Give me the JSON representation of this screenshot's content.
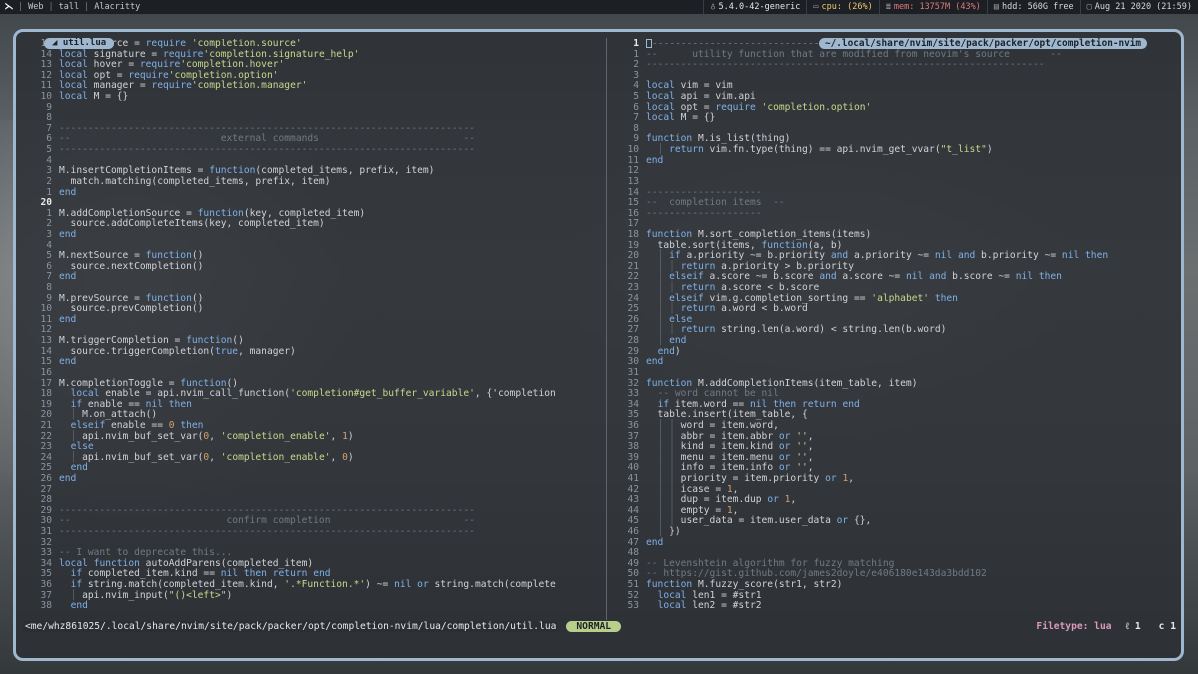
{
  "topbar": {
    "logo": "⋋",
    "workspaces": [
      "Web",
      "tall",
      "Alacritty"
    ],
    "kernel_icon": "♁",
    "kernel": "5.4.0-42-generic",
    "cpu_icon": "▭",
    "cpu": "cpu: (26%)",
    "mem_icon": "≣",
    "mem": "mem: 13757M (43%)",
    "hdd_icon": "▤",
    "hdd": "hdd: 560G free",
    "date_icon": "▢",
    "date": "Aug 21 2020 (21:59)"
  },
  "editor": {
    "left_tab": "◢ util.lua",
    "right_path": "~/.local/share/nvim/site/pack/packer/opt/completion-nvim",
    "left_lines": [
      {
        "n": "15",
        "c": "local source = require 'completion.source'"
      },
      {
        "n": "14",
        "c": "local signature = require'completion.signature_help'"
      },
      {
        "n": "13",
        "c": "local hover = require'completion.hover'"
      },
      {
        "n": "12",
        "c": "local opt = require'completion.option'"
      },
      {
        "n": "11",
        "c": "local manager = require'completion.manager'"
      },
      {
        "n": "10",
        "c": "local M = {}"
      },
      {
        "n": "9",
        "c": ""
      },
      {
        "n": "8",
        "c": ""
      },
      {
        "n": "7",
        "c": "------------------------------------------------------------------------"
      },
      {
        "n": "6",
        "c": "--                          external commands                         --"
      },
      {
        "n": "5",
        "c": "------------------------------------------------------------------------"
      },
      {
        "n": "4",
        "c": ""
      },
      {
        "n": "3",
        "c": "M.insertCompletionItems = function(completed_items, prefix, item)"
      },
      {
        "n": "2",
        "c": "  match.matching(completed_items, prefix, item)"
      },
      {
        "n": "1",
        "c": "end"
      },
      {
        "n": "20",
        "c": "",
        "cur": true
      },
      {
        "n": "1",
        "c": "M.addCompletionSource = function(key, completed_item)"
      },
      {
        "n": "2",
        "c": "  source.addCompleteItems(key, completed_item)"
      },
      {
        "n": "3",
        "c": "end"
      },
      {
        "n": "4",
        "c": ""
      },
      {
        "n": "5",
        "c": "M.nextSource = function()"
      },
      {
        "n": "6",
        "c": "  source.nextCompletion()"
      },
      {
        "n": "7",
        "c": "end"
      },
      {
        "n": "8",
        "c": ""
      },
      {
        "n": "9",
        "c": "M.prevSource = function()"
      },
      {
        "n": "10",
        "c": "  source.prevCompletion()"
      },
      {
        "n": "11",
        "c": "end"
      },
      {
        "n": "12",
        "c": ""
      },
      {
        "n": "13",
        "c": "M.triggerCompletion = function()"
      },
      {
        "n": "14",
        "c": "  source.triggerCompletion(true, manager)"
      },
      {
        "n": "15",
        "c": "end"
      },
      {
        "n": "16",
        "c": ""
      },
      {
        "n": "17",
        "c": "M.completionToggle = function()"
      },
      {
        "n": "18",
        "c": "  local enable = api.nvim_call_function('completion#get_buffer_variable', {'completion"
      },
      {
        "n": "19",
        "c": "  if enable == nil then"
      },
      {
        "n": "20",
        "c": "  │ M.on_attach()"
      },
      {
        "n": "21",
        "c": "  elseif enable == 0 then"
      },
      {
        "n": "22",
        "c": "  │ api.nvim_buf_set_var(0, 'completion_enable', 1)"
      },
      {
        "n": "23",
        "c": "  else"
      },
      {
        "n": "24",
        "c": "  │ api.nvim_buf_set_var(0, 'completion_enable', 0)"
      },
      {
        "n": "25",
        "c": "  end"
      },
      {
        "n": "26",
        "c": "end"
      },
      {
        "n": "27",
        "c": ""
      },
      {
        "n": "28",
        "c": ""
      },
      {
        "n": "29",
        "c": "------------------------------------------------------------------------"
      },
      {
        "n": "30",
        "c": "--                           confirm completion                       --"
      },
      {
        "n": "31",
        "c": "------------------------------------------------------------------------"
      },
      {
        "n": "32",
        "c": ""
      },
      {
        "n": "33",
        "c": "-- I want to deprecate this..."
      },
      {
        "n": "34",
        "c": "local function autoAddParens(completed_item)"
      },
      {
        "n": "35",
        "c": "  if completed_item.kind == nil then return end"
      },
      {
        "n": "36",
        "c": "  if string.match(completed_item.kind, '.*Function.*') ~= nil or string.match(complete"
      },
      {
        "n": "37",
        "c": "  │ api.nvim_input(\"()<left>\")"
      },
      {
        "n": "38",
        "c": "  end"
      }
    ],
    "right_lines": [
      {
        "n": "1",
        "c": "▯---------------------------------------------------------------------",
        "cur": true
      },
      {
        "n": "1",
        "c": "--      utility function that are modified from neovim's source       --"
      },
      {
        "n": "2",
        "c": "---------------------------------------------------------------------"
      },
      {
        "n": "3",
        "c": ""
      },
      {
        "n": "4",
        "c": "local vim = vim"
      },
      {
        "n": "5",
        "c": "local api = vim.api"
      },
      {
        "n": "6",
        "c": "local opt = require 'completion.option'"
      },
      {
        "n": "7",
        "c": "local M = {}"
      },
      {
        "n": "8",
        "c": ""
      },
      {
        "n": "9",
        "c": "function M.is_list(thing)"
      },
      {
        "n": "10",
        "c": "  │ return vim.fn.type(thing) == api.nvim_get_vvar(\"t_list\")"
      },
      {
        "n": "11",
        "c": "end"
      },
      {
        "n": "12",
        "c": ""
      },
      {
        "n": "13",
        "c": ""
      },
      {
        "n": "14",
        "c": "--------------------"
      },
      {
        "n": "15",
        "c": "--  completion items  --"
      },
      {
        "n": "16",
        "c": "--------------------"
      },
      {
        "n": "17",
        "c": ""
      },
      {
        "n": "18",
        "c": "function M.sort_completion_items(items)"
      },
      {
        "n": "19",
        "c": "  table.sort(items, function(a, b)"
      },
      {
        "n": "20",
        "c": "  │ if a.priority ~= b.priority and a.priority ~= nil and b.priority ~= nil then"
      },
      {
        "n": "21",
        "c": "  │ │ return a.priority > b.priority"
      },
      {
        "n": "22",
        "c": "  │ elseif a.score ~= b.score and a.score ~= nil and b.score ~= nil then"
      },
      {
        "n": "23",
        "c": "  │ │ return a.score < b.score"
      },
      {
        "n": "24",
        "c": "  │ elseif vim.g.completion_sorting == 'alphabet' then"
      },
      {
        "n": "25",
        "c": "  │ │ return a.word < b.word"
      },
      {
        "n": "26",
        "c": "  │ else"
      },
      {
        "n": "27",
        "c": "  │ │ return string.len(a.word) < string.len(b.word)"
      },
      {
        "n": "28",
        "c": "  │ end"
      },
      {
        "n": "29",
        "c": "  end)"
      },
      {
        "n": "30",
        "c": "end"
      },
      {
        "n": "31",
        "c": ""
      },
      {
        "n": "32",
        "c": "function M.addCompletionItems(item_table, item)"
      },
      {
        "n": "33",
        "c": "  -- word cannot be nil"
      },
      {
        "n": "34",
        "c": "  if item.word == nil then return end"
      },
      {
        "n": "35",
        "c": "  table.insert(item_table, {"
      },
      {
        "n": "36",
        "c": "  │ │ word = item.word,"
      },
      {
        "n": "37",
        "c": "  │ │ abbr = item.abbr or '',"
      },
      {
        "n": "38",
        "c": "  │ │ kind = item.kind or '',"
      },
      {
        "n": "39",
        "c": "  │ │ menu = item.menu or '',"
      },
      {
        "n": "40",
        "c": "  │ │ info = item.info or '',"
      },
      {
        "n": "41",
        "c": "  │ │ priority = item.priority or 1,"
      },
      {
        "n": "42",
        "c": "  │ │ icase = 1,"
      },
      {
        "n": "43",
        "c": "  │ │ dup = item.dup or 1,"
      },
      {
        "n": "44",
        "c": "  │ │ empty = 1,"
      },
      {
        "n": "45",
        "c": "  │ │ user_data = item.user_data or {},"
      },
      {
        "n": "46",
        "c": "  │ })"
      },
      {
        "n": "47",
        "c": "end"
      },
      {
        "n": "48",
        "c": ""
      },
      {
        "n": "49",
        "c": "-- Levenshtein algorithm for fuzzy matching"
      },
      {
        "n": "50",
        "c": "-- https://gist.github.com/james2doyle/e406180e143da3bdd102"
      },
      {
        "n": "51",
        "c": "function M.fuzzy_score(str1, str2)"
      },
      {
        "n": "52",
        "c": "  local len1 = #str1"
      },
      {
        "n": "53",
        "c": "  local len2 = #str2"
      }
    ],
    "status": {
      "path": "<me/whz861025/.local/share/nvim/site/pack/packer/opt/completion-nvim/lua/completion/util.lua",
      "mode": "NORMAL",
      "filetype": "Filetype: lua",
      "line": "ℓ 1",
      "col": "c 1"
    }
  }
}
